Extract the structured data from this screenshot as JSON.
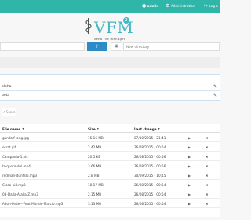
{
  "topbar": {
    "user": "admin",
    "administration": "Administration",
    "logout": "Log o"
  },
  "logo": {
    "title": "VFM",
    "badge": "2",
    "tagline": "veno file manager"
  },
  "toolbar": {
    "new_directory_placeholder": "New directory"
  },
  "folders": [
    {
      "name": "alpha"
    },
    {
      "name": "beta"
    }
  ],
  "share_label": "Share",
  "files": {
    "headers": {
      "name": "File name ↕",
      "size": "Size ↕",
      "date": "Last change ↕"
    },
    "rows": [
      {
        "name": "gandalf-long.jpg",
        "size": "15.16 MB",
        "date": "07/10/2015 - 21:41"
      },
      {
        "name": "scrat.gif",
        "size": "2.42 MB",
        "date": "26/08/2015 - 00:54"
      },
      {
        "name": "Campania-1.xls",
        "size": "20.5 KB",
        "date": "26/08/2015 - 00:56"
      },
      {
        "name": "la-quota-del.mp4",
        "size": "3.66 MB",
        "date": "26/08/2015 - 00:56"
      },
      {
        "name": "redman-dunfalo.mp3",
        "size": "2.8 MB",
        "date": "30/09/2015 - 10:15"
      },
      {
        "name": "Cisco-kid.mp3",
        "size": "10.17 MB",
        "date": "26/08/2015 - 00:54"
      },
      {
        "name": "03-Dalla-A-alla-Z.mp3",
        "size": "2.15 MB",
        "date": "26/08/2015 - 00:54"
      },
      {
        "name": "Adon-Fede---Feat-Monde-Marcio.mp3",
        "size": "3.13 MB",
        "date": "26/08/2015 - 00:54"
      }
    ]
  },
  "colors": {
    "topbar": "#30b5a9",
    "brand": "#45b8c4",
    "upload_button": "#2c8ac5"
  }
}
